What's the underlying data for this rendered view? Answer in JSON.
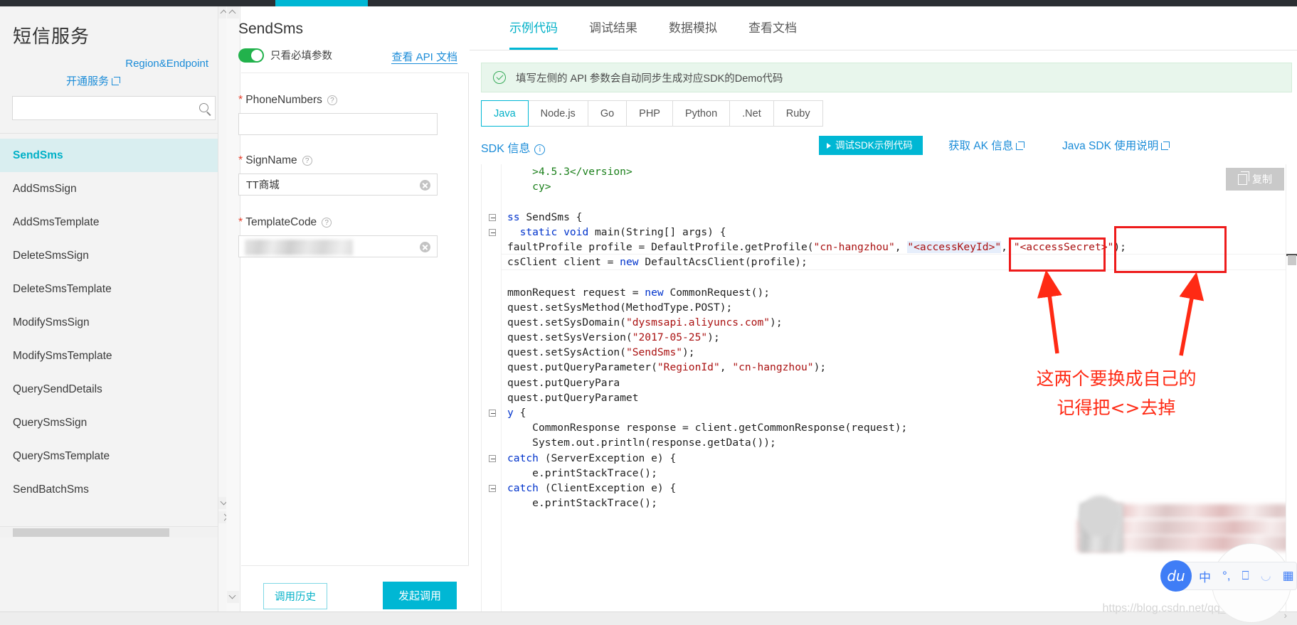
{
  "browser": {
    "active_tab_color": "#00b7d4"
  },
  "sidebar": {
    "title": "短信服务",
    "links": [
      {
        "name": "region-endpoint",
        "label": "Region&Endpoint"
      },
      {
        "name": "open-service",
        "label": "开通服务"
      }
    ],
    "search": {
      "value": "",
      "placeholder": ""
    },
    "items": [
      {
        "label": "SendSms",
        "active": true
      },
      {
        "label": "AddSmsSign",
        "active": false
      },
      {
        "label": "AddSmsTemplate",
        "active": false
      },
      {
        "label": "DeleteSmsSign",
        "active": false
      },
      {
        "label": "DeleteSmsTemplate",
        "active": false
      },
      {
        "label": "ModifySmsSign",
        "active": false
      },
      {
        "label": "ModifySmsTemplate",
        "active": false
      },
      {
        "label": "QuerySendDetails",
        "active": false
      },
      {
        "label": "QuerySmsSign",
        "active": false
      },
      {
        "label": "QuerySmsTemplate",
        "active": false
      },
      {
        "label": "SendBatchSms",
        "active": false
      }
    ]
  },
  "form": {
    "title": "SendSms",
    "toggle_label": "只看必填参数",
    "toggle_on": true,
    "api_doc_label": "查看 API 文档",
    "fields": [
      {
        "label": "PhoneNumbers",
        "required": true,
        "value": "",
        "redacted": false,
        "clearable": false
      },
      {
        "label": "SignName",
        "required": true,
        "value": "TT商城",
        "redacted": false,
        "clearable": true
      },
      {
        "label": "TemplateCode",
        "required": true,
        "value": "",
        "redacted": true,
        "clearable": true
      }
    ],
    "history_button": "调用历史",
    "invoke_button": "发起调用"
  },
  "right": {
    "tabs": [
      {
        "label": "示例代码",
        "active": true
      },
      {
        "label": "调试结果",
        "active": false
      },
      {
        "label": "数据模拟",
        "active": false
      },
      {
        "label": "查看文档",
        "active": false
      }
    ],
    "notice": "填写左侧的 API 参数会自动同步生成对应SDK的Demo代码",
    "languages": [
      {
        "label": "Java",
        "active": true
      },
      {
        "label": "Node.js",
        "active": false
      },
      {
        "label": "Go",
        "active": false
      },
      {
        "label": "PHP",
        "active": false
      },
      {
        "label": "Python",
        "active": false
      },
      {
        "label": ".Net",
        "active": false
      },
      {
        "label": "Ruby",
        "active": false
      }
    ],
    "sdk_info_label": "SDK 信息",
    "debug_button": "调试SDK示例代码",
    "ak_link": "获取 AK 信息",
    "java_sdk_link": "Java SDK 使用说明",
    "copy_button": "复制"
  },
  "code": {
    "language": "java",
    "lines": [
      {
        "indent": 2,
        "fold": false,
        "tokens": [
          {
            "t": ">4.5.3</version>",
            "c": "c"
          }
        ]
      },
      {
        "indent": 2,
        "fold": false,
        "tokens": [
          {
            "t": "cy>",
            "c": "c"
          }
        ]
      },
      {
        "indent": 0,
        "fold": false,
        "tokens": []
      },
      {
        "indent": 0,
        "fold": true,
        "tokens": [
          {
            "t": "ss ",
            "c": "k"
          },
          {
            "t": "SendSms {",
            "c": ""
          }
        ]
      },
      {
        "indent": 1,
        "fold": true,
        "tokens": [
          {
            "t": "static void ",
            "c": "k"
          },
          {
            "t": "main(String[] args) {",
            "c": ""
          }
        ]
      },
      {
        "indent": 0,
        "fold": false,
        "tokens": [
          {
            "t": "faultProfile profile = DefaultProfile.getProfile(",
            "c": ""
          },
          {
            "t": "\"cn-hangzhou\"",
            "c": "s"
          },
          {
            "t": ", ",
            "c": ""
          },
          {
            "t": "\"<accessKeyId>\"",
            "c": "s hl"
          },
          {
            "t": ", ",
            "c": ""
          },
          {
            "t": "\"<accessSecret>\"",
            "c": "s"
          },
          {
            "t": ");",
            "c": ""
          }
        ]
      },
      {
        "indent": 0,
        "fold": false,
        "tokens": [
          {
            "t": "csClient client = ",
            "c": ""
          },
          {
            "t": "new ",
            "c": "k"
          },
          {
            "t": "DefaultAcsClient(profile);",
            "c": ""
          }
        ]
      },
      {
        "indent": 0,
        "fold": false,
        "tokens": []
      },
      {
        "indent": 0,
        "fold": false,
        "tokens": [
          {
            "t": "mmonRequest request = ",
            "c": ""
          },
          {
            "t": "new ",
            "c": "k"
          },
          {
            "t": "CommonRequest();",
            "c": ""
          }
        ]
      },
      {
        "indent": 0,
        "fold": false,
        "tokens": [
          {
            "t": "quest.setSysMethod(MethodType.POST);",
            "c": ""
          }
        ]
      },
      {
        "indent": 0,
        "fold": false,
        "tokens": [
          {
            "t": "quest.setSysDomain(",
            "c": ""
          },
          {
            "t": "\"dysmsapi.aliyuncs.com\"",
            "c": "s"
          },
          {
            "t": ");",
            "c": ""
          }
        ]
      },
      {
        "indent": 0,
        "fold": false,
        "tokens": [
          {
            "t": "quest.setSysVersion(",
            "c": ""
          },
          {
            "t": "\"2017-05-25\"",
            "c": "s"
          },
          {
            "t": ");",
            "c": ""
          }
        ]
      },
      {
        "indent": 0,
        "fold": false,
        "tokens": [
          {
            "t": "quest.setSysAction(",
            "c": ""
          },
          {
            "t": "\"SendSms\"",
            "c": "s"
          },
          {
            "t": ");",
            "c": ""
          }
        ]
      },
      {
        "indent": 0,
        "fold": false,
        "tokens": [
          {
            "t": "quest.putQueryParameter(",
            "c": ""
          },
          {
            "t": "\"RegionId\"",
            "c": "s"
          },
          {
            "t": ", ",
            "c": ""
          },
          {
            "t": "\"cn-hangzhou\"",
            "c": "s"
          },
          {
            "t": ");",
            "c": ""
          }
        ]
      },
      {
        "indent": 0,
        "fold": false,
        "tokens": [
          {
            "t": "quest.putQueryPara",
            "c": ""
          }
        ]
      },
      {
        "indent": 0,
        "fold": false,
        "tokens": [
          {
            "t": "quest.putQueryParamet",
            "c": ""
          }
        ]
      },
      {
        "indent": 0,
        "fold": true,
        "tokens": [
          {
            "t": "y ",
            "c": "k"
          },
          {
            "t": "{",
            "c": ""
          }
        ]
      },
      {
        "indent": 2,
        "fold": false,
        "tokens": [
          {
            "t": "CommonResponse response = client.getCommonResponse(request);",
            "c": ""
          }
        ]
      },
      {
        "indent": 2,
        "fold": false,
        "tokens": [
          {
            "t": "System.out.println(response.getData());",
            "c": ""
          }
        ]
      },
      {
        "indent": 0,
        "fold": true,
        "tokens": [
          {
            "t": "catch ",
            "c": "k"
          },
          {
            "t": "(ServerException e) {",
            "c": ""
          }
        ]
      },
      {
        "indent": 2,
        "fold": false,
        "tokens": [
          {
            "t": "e.printStackTrace();",
            "c": ""
          }
        ]
      },
      {
        "indent": 0,
        "fold": true,
        "tokens": [
          {
            "t": "catch ",
            "c": "k"
          },
          {
            "t": "(ClientException e) {",
            "c": ""
          }
        ]
      },
      {
        "indent": 2,
        "fold": false,
        "tokens": [
          {
            "t": "e.printStackTrace();",
            "c": ""
          }
        ]
      }
    ]
  },
  "annotations": {
    "boxes": [
      {
        "name": "access-key-id-box",
        "target": "\"<accessKeyId>\"",
        "color": "#ee1b1b"
      },
      {
        "name": "access-secret-box",
        "target": "\"<accessSecret>\"",
        "color": "#ee1b1b"
      }
    ],
    "note_line1": "这两个要换成自己的",
    "note_line2": "记得把<>去掉",
    "note_color": "#ff2a14"
  },
  "ime": {
    "logo_text": "du",
    "buttons": [
      "中",
      "°,",
      "keyboard-icon",
      "user-icon",
      "grid-icon"
    ]
  },
  "magnifier": {
    "text": "开通服务"
  },
  "watermark": "https://blog.csdn.net/qq_44664329"
}
